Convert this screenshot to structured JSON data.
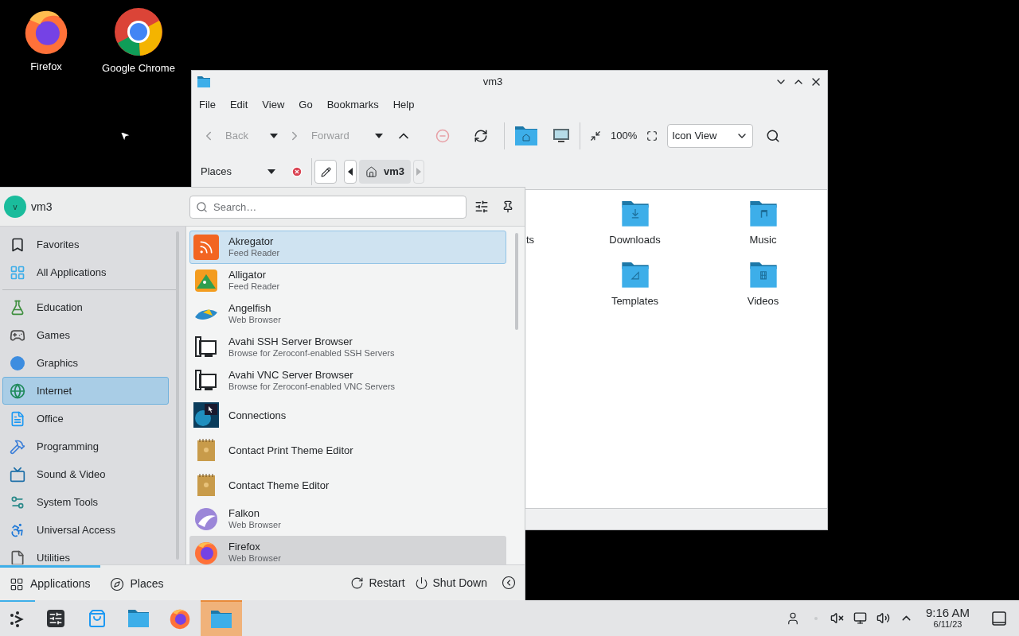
{
  "desktop_icons": [
    {
      "label": "Firefox"
    },
    {
      "label": "Google Chrome"
    }
  ],
  "file_manager": {
    "title": "vm3",
    "menu": [
      "File",
      "Edit",
      "View",
      "Go",
      "Bookmarks",
      "Help"
    ],
    "toolbar": {
      "back": "Back",
      "forward": "Forward",
      "zoom": "100%",
      "view_mode": "Icon View"
    },
    "places_label": "Places",
    "breadcrumb": "vm3",
    "items": [
      {
        "label": "ts"
      },
      {
        "label": "Downloads"
      },
      {
        "label": "Music"
      },
      {
        "label": "Templates"
      },
      {
        "label": "Videos"
      }
    ]
  },
  "launcher": {
    "user": "vm3",
    "avatar": "v",
    "search": {
      "placeholder": "Search…"
    },
    "category_groups": [
      [
        {
          "label": "Favorites",
          "selected": false
        },
        {
          "label": "All Applications",
          "selected": false
        }
      ],
      [
        {
          "label": "Education",
          "selected": false
        },
        {
          "label": "Games",
          "selected": false
        },
        {
          "label": "Graphics",
          "selected": false
        },
        {
          "label": "Internet",
          "selected": true
        },
        {
          "label": "Office",
          "selected": false
        },
        {
          "label": "Programming",
          "selected": false
        },
        {
          "label": "Sound & Video",
          "selected": false
        },
        {
          "label": "System Tools",
          "selected": false
        },
        {
          "label": "Universal Access",
          "selected": false
        },
        {
          "label": "Utilities",
          "selected": false
        }
      ]
    ],
    "apps": [
      {
        "name": "Akregator",
        "description": "Feed Reader",
        "hovered": true,
        "selected": false
      },
      {
        "name": "Alligator",
        "description": "Feed Reader",
        "hovered": false,
        "selected": false
      },
      {
        "name": "Angelfish",
        "description": "Web Browser",
        "hovered": false,
        "selected": false
      },
      {
        "name": "Avahi SSH Server Browser",
        "description": "Browse for Zeroconf-enabled SSH Servers",
        "hovered": false,
        "selected": false
      },
      {
        "name": "Avahi VNC Server Browser",
        "description": "Browse for Zeroconf-enabled VNC Servers",
        "hovered": false,
        "selected": false
      },
      {
        "name": "Connections",
        "hovered": false,
        "selected": false
      },
      {
        "name": "Contact Print Theme Editor",
        "hovered": false,
        "selected": false
      },
      {
        "name": "Contact Theme Editor",
        "hovered": false,
        "selected": false
      },
      {
        "name": "Falkon",
        "description": "Web Browser",
        "hovered": false,
        "selected": false
      },
      {
        "name": "Firefox",
        "description": "Web Browser",
        "hovered": false,
        "selected": true
      }
    ],
    "tabs": [
      {
        "label": "Applications",
        "selected": true
      },
      {
        "label": "Places",
        "selected": false
      }
    ],
    "actions": [
      "Restart",
      "Shut Down"
    ]
  },
  "taskbar": {
    "tasks": [
      {
        "active": false
      },
      {
        "active": false
      },
      {
        "active": false
      },
      {
        "active": false
      },
      {
        "active": true
      }
    ],
    "clock": {
      "time": "9:16 AM",
      "date": "6/11/23"
    }
  }
}
